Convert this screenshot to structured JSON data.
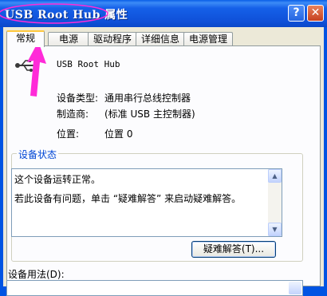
{
  "window": {
    "title": "USB Root Hub 属性",
    "help_glyph": "?",
    "close_glyph": "✕"
  },
  "tabs": [
    {
      "label": "常规",
      "active": true
    },
    {
      "label": "电源",
      "active": false
    },
    {
      "label": "驱动程序",
      "active": false
    },
    {
      "label": "详细信息",
      "active": false
    },
    {
      "label": "电源管理",
      "active": false
    }
  ],
  "device": {
    "icon": "usb-icon",
    "name": "USB Root Hub",
    "type_label": "设备类型:",
    "type_value": "通用串行总线控制器",
    "manufacturer_label": "制造商:",
    "manufacturer_value": "(标准 USB 主控制器)",
    "location_label": "位置:",
    "location_value": "位置 0"
  },
  "status": {
    "group_title": "设备状态",
    "line1": "这个设备运转正常。",
    "line2": "若此设备有问题，单击 “疑难解答” 来启动疑难解答。",
    "troubleshoot_label": "疑难解答(T)..."
  },
  "usage": {
    "label": "设备用法(D):"
  },
  "colors": {
    "titlebar": "#0054e3",
    "dialog_bg": "#ece9d8",
    "annotation": "#ff2bd8",
    "group_title": "#0046d5"
  }
}
